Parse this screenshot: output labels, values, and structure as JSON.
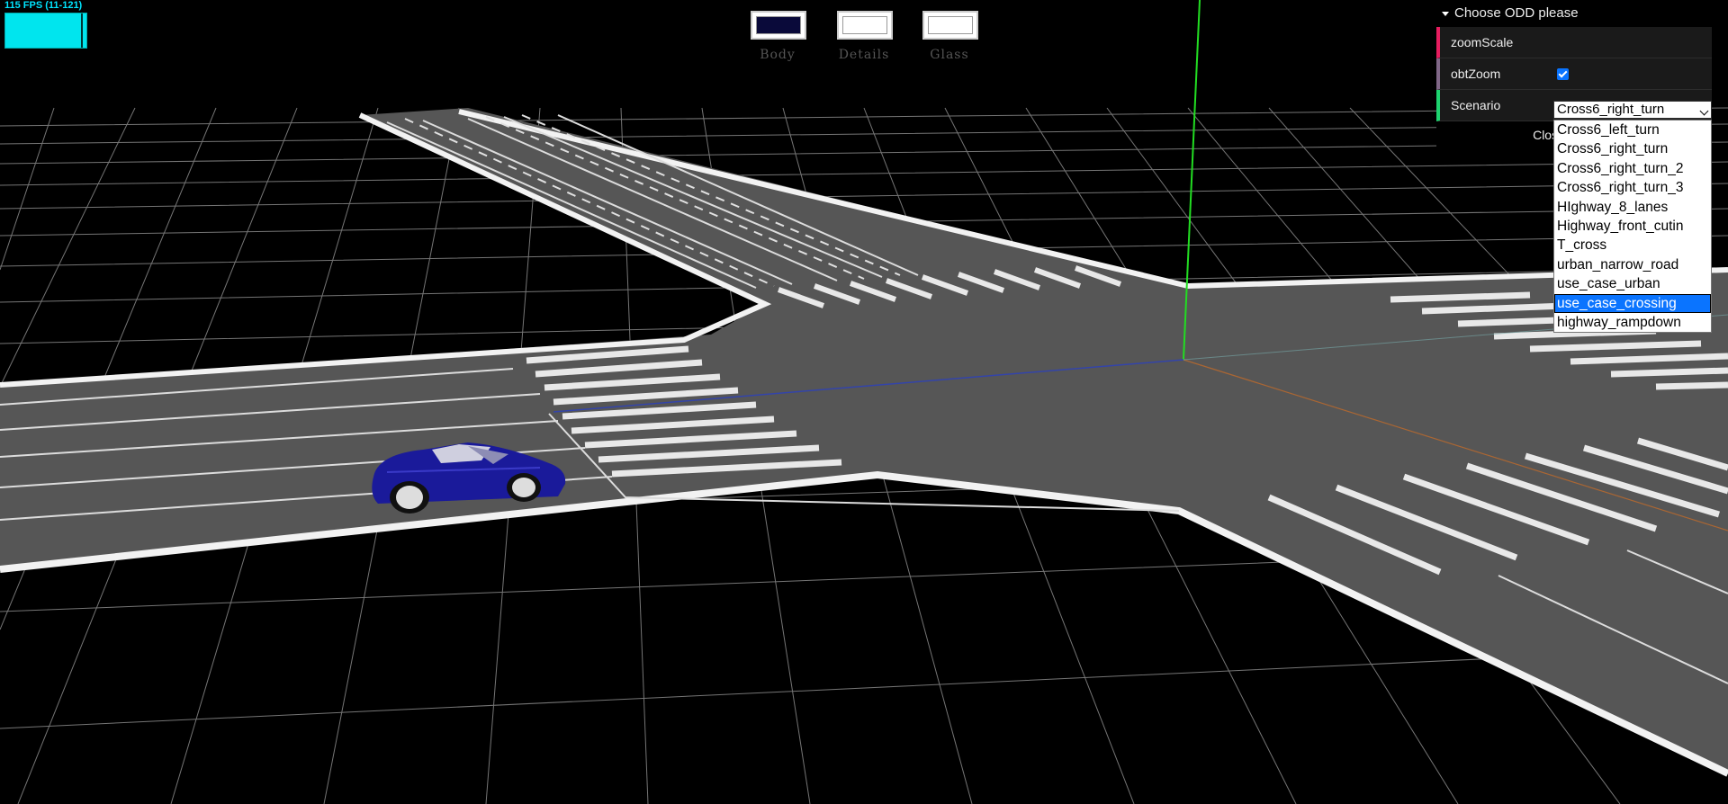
{
  "stats": {
    "fps_text": "115 FPS (11-121)"
  },
  "materials": [
    {
      "label": "Body",
      "color": "#0a0a3a"
    },
    {
      "label": "Details",
      "color": "#ffffff"
    },
    {
      "label": "Glass",
      "color": "#ffffff"
    }
  ],
  "gui": {
    "folder_title": "Choose ODD please",
    "rows": {
      "zoom_scale_label": "zoomScale",
      "obt_zoom_label": "obtZoom",
      "obt_zoom_checked": true,
      "scenario_label": "Scenario"
    },
    "close_label": "Close Controls",
    "scenario_selected": "Cross6_right_turn",
    "scenario_options": [
      "Cross6_left_turn",
      "Cross6_right_turn",
      "Cross6_right_turn_2",
      "Cross6_right_turn_3",
      "HIghway_8_lanes",
      "Highway_front_cutin",
      "T_cross",
      "urban_narrow_road",
      "use_case_urban",
      "use_case_crossing",
      "highway_rampdown"
    ],
    "highlighted_option": "use_case_crossing"
  },
  "colors": {
    "road": "#555555",
    "grid": "#9a9a9a",
    "car_body": "#1a1a9a",
    "axis_y": "#22dd22",
    "axis_z": "#3344aa",
    "axis_x": "#aa6633"
  }
}
